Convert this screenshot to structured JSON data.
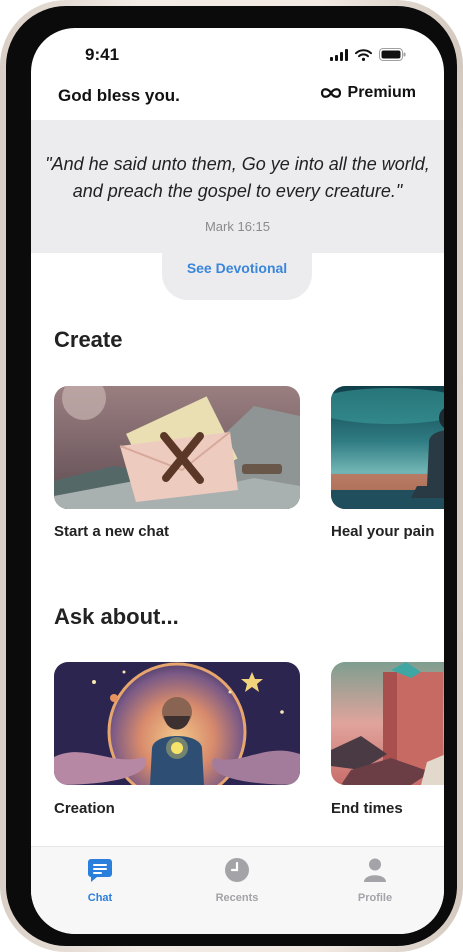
{
  "status_bar": {
    "time": "9:41"
  },
  "header": {
    "greeting": "God bless you.",
    "premium_label": "Premium"
  },
  "verse": {
    "text": "\"And he said unto them, Go ye into all the world, and preach the gospel to every creature.\"",
    "reference": "Mark 16:15",
    "button_label": "See Devotional"
  },
  "sections": {
    "create": {
      "title": "Create",
      "cards": [
        {
          "label": "Start a new chat"
        },
        {
          "label": "Heal your pain"
        }
      ]
    },
    "ask": {
      "title": "Ask about...",
      "cards": [
        {
          "label": "Creation"
        },
        {
          "label": "End times"
        }
      ]
    }
  },
  "tabs": [
    {
      "label": "Chat",
      "icon": "chat-bubble-icon",
      "active": true
    },
    {
      "label": "Recents",
      "icon": "clock-icon",
      "active": false
    },
    {
      "label": "Profile",
      "icon": "person-icon",
      "active": false
    }
  ],
  "colors": {
    "accent": "#2a7fdc",
    "inactive_tab": "#a3a3a8",
    "verse_background": "#ececee"
  }
}
